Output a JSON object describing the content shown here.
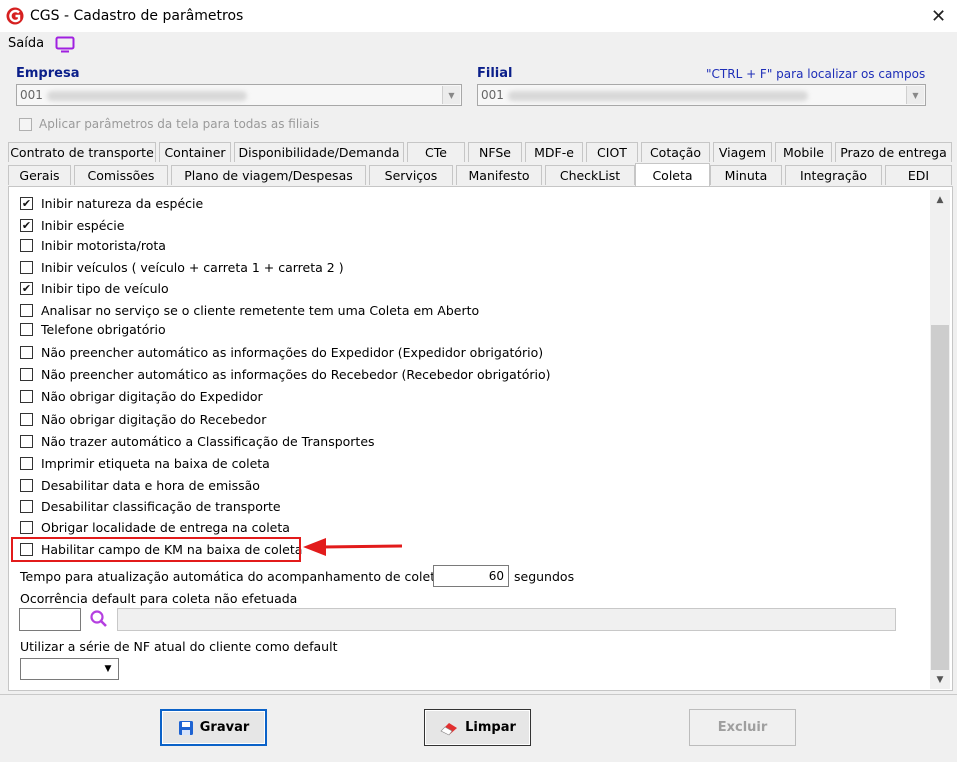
{
  "window": {
    "title": "CGS - Cadastro de parâmetros",
    "close_glyph": "✕"
  },
  "menu": {
    "saida": "Saída"
  },
  "empresa": {
    "label": "Empresa",
    "code": "001"
  },
  "filial": {
    "label": "Filial",
    "code": "001"
  },
  "hint": "\"CTRL + F\" para localizar os campos",
  "apply_all": {
    "label": "Aplicar parâmetros da tela para todas as filiais",
    "checked": false
  },
  "tabs_row1": [
    "Contrato de transporte",
    "Container",
    "Disponibilidade/Demanda",
    "CTe",
    "NFSe",
    "MDF-e",
    "CIOT",
    "Cotação",
    "Viagem",
    "Mobile",
    "Prazo de entrega"
  ],
  "tabs_row2": [
    "Gerais",
    "Comissões",
    "Plano de viagem/Despesas",
    "Serviços",
    "Manifesto",
    "CheckList",
    "Coleta",
    "Minuta",
    "Integração",
    "EDI"
  ],
  "active_tab": "Coleta",
  "options": [
    {
      "label": "Inibir natureza da espécie",
      "checked": true
    },
    {
      "label": "Inibir espécie",
      "checked": true
    },
    {
      "label": "Inibir motorista/rota",
      "checked": false
    },
    {
      "label": "Inibir veículos ( veículo + carreta 1 + carreta 2 )",
      "checked": false
    },
    {
      "label": "Inibir tipo de veículo",
      "checked": true
    },
    {
      "label": "Analisar no serviço se o cliente remetente tem uma Coleta em Aberto",
      "checked": false
    },
    {
      "label": "Telefone obrigatório",
      "checked": false
    },
    {
      "label": "Não preencher automático as informações do Expedidor (Expedidor obrigatório)",
      "checked": false
    },
    {
      "label": "Não preencher automático as informações do Recebedor (Recebedor obrigatório)",
      "checked": false
    },
    {
      "label": "Não obrigar digitação do Expedidor",
      "checked": false
    },
    {
      "label": "Não obrigar digitação do Recebedor",
      "checked": false
    },
    {
      "label": "Não trazer automático a Classificação de Transportes",
      "checked": false
    },
    {
      "label": "Imprimir etiqueta na baixa de coleta",
      "checked": false
    },
    {
      "label": "Desabilitar data e hora de emissão",
      "checked": false
    },
    {
      "label": "Desabilitar classificação de transporte",
      "checked": false
    },
    {
      "label": "Obrigar localidade de entrega na coleta",
      "checked": false
    },
    {
      "label": "Habilitar campo de KM na baixa de coleta",
      "checked": false
    }
  ],
  "update_time": {
    "label": "Tempo para atualização automática do acompanhamento de coletas",
    "value": "60",
    "unit": "segundos"
  },
  "default_occurrence": {
    "label": "Ocorrência default para coleta não efetuada",
    "code": "",
    "description": ""
  },
  "nf_series": {
    "label": "Utilizar a série de NF atual do cliente  como default",
    "value": ""
  },
  "buttons": {
    "gravar": "Gravar",
    "limpar": "Limpar",
    "excluir": "Excluir"
  },
  "colors": {
    "highlight": "#e21b1b",
    "label_blue": "#0b1f8a",
    "hint_blue": "#1f2fb8"
  }
}
